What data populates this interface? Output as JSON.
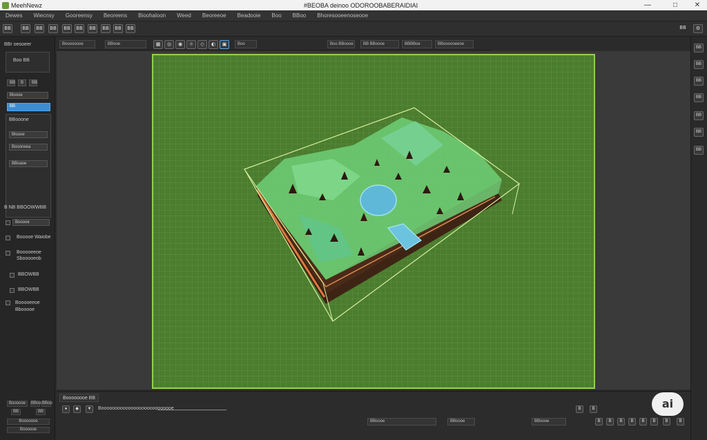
{
  "window": {
    "app_name": "MeehNewz",
    "doc_title": "#BEOBA deinoo ODOROOBABERAIDIAI",
    "minimize": "—",
    "maximize": "□",
    "close": "✕"
  },
  "menu": [
    "Dewes",
    "Wiecnsy",
    "Gooreensy",
    "Beoreens",
    "Bioohaloon",
    "Weed",
    "Beoreeoe",
    "Beadooie",
    "Boo",
    "BBoo",
    "Bhoresooeenoseooe"
  ],
  "toolbar": {
    "left_buttons": [
      "BB",
      "BB",
      "BB",
      "BB",
      "BB",
      "BB",
      "BB",
      "BB",
      "BB",
      "BB"
    ],
    "right_label": "BB"
  },
  "left_panel": {
    "header": "BBr oeooeer",
    "box_label": "Boo BB",
    "tabs": [
      "BB",
      "B",
      "BB"
    ],
    "field_1": "Bloooe",
    "selected_item": "BB",
    "section_label": "BBooone",
    "fields": [
      "Bloooe",
      "Boooneea",
      "BBoaoe"
    ],
    "tools_header": "B NB BBOOWWBB",
    "tool_rows": [
      {
        "label": "Booooe"
      },
      {
        "label": "Booooe Waiobe"
      },
      {
        "label": "Booooeeoe Sbooooeob"
      },
      {
        "label": "BBOWBB"
      },
      {
        "label": "BBOWBB"
      },
      {
        "label": "Booooeeoe Bbooooe"
      }
    ],
    "bottom_cells": [
      "Boooooe",
      "BBoo",
      "BBoo",
      "BB",
      "BB",
      "Booooooe",
      "Boooooe"
    ]
  },
  "viewport_header": {
    "fields": [
      "Boooooooe",
      "BBooe",
      "Boo",
      "Boo BBoooe",
      "BB BBoooe",
      "BBBBoe",
      "BBoooooeeoe"
    ]
  },
  "right_toolbar": [
    "BB",
    "BB",
    "BB",
    "BB",
    "BB",
    "BB",
    "BB"
  ],
  "timeline": {
    "tab": "Boooooooe BB",
    "row1_label": "Booooooooooooooooooooooooooe",
    "row2_fields": [
      "BBoooe",
      "BBoooe",
      "BBoooe"
    ],
    "right_buttons": [
      "B",
      "B",
      "B",
      "B",
      "B",
      "B",
      "B",
      "B",
      "B",
      "B"
    ]
  },
  "badge": "ai",
  "colors": {
    "canvas_bg": "#4b7d2e",
    "canvas_border": "#8fd050",
    "selected": "#3b8ed6",
    "water": "#5fb8d8",
    "soil": "#4a2a18"
  }
}
